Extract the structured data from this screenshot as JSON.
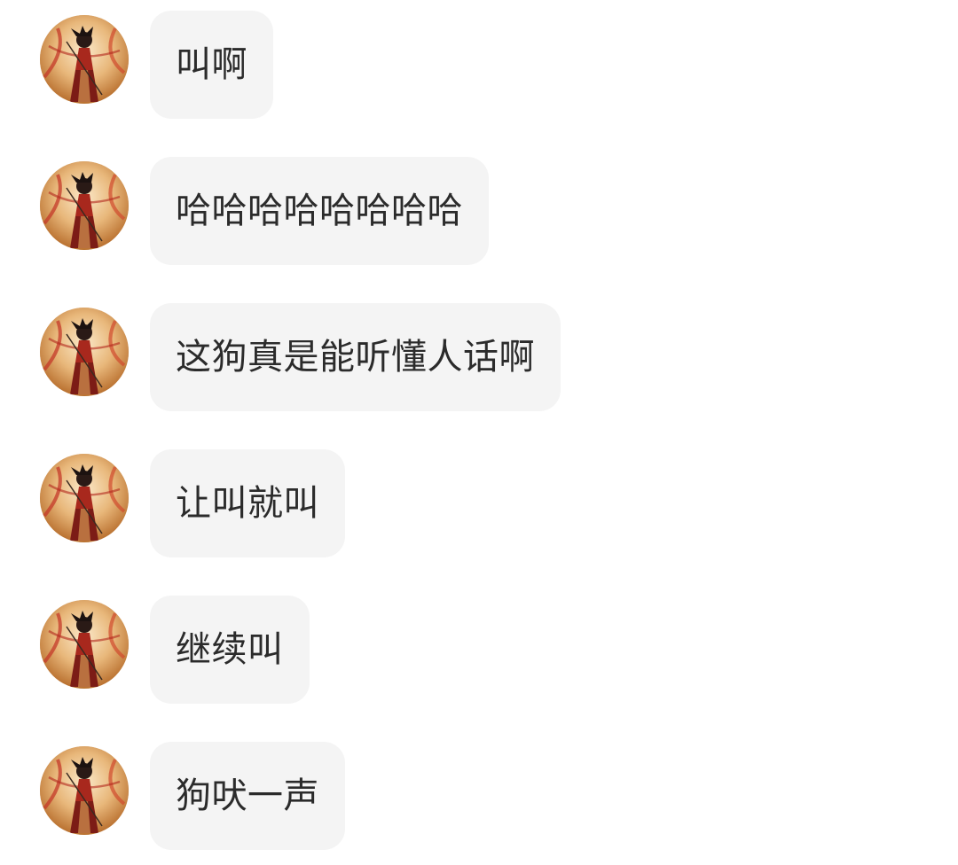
{
  "chat": {
    "messages": [
      {
        "sender_avatar": "anime-warrior-avatar",
        "text": "叫啊"
      },
      {
        "sender_avatar": "anime-warrior-avatar",
        "text": "哈哈哈哈哈哈哈哈"
      },
      {
        "sender_avatar": "anime-warrior-avatar",
        "text": "这狗真是能听懂人话啊"
      },
      {
        "sender_avatar": "anime-warrior-avatar",
        "text": "让叫就叫"
      },
      {
        "sender_avatar": "anime-warrior-avatar",
        "text": "继续叫"
      },
      {
        "sender_avatar": "anime-warrior-avatar",
        "text": "狗吠一声"
      }
    ]
  },
  "colors": {
    "background": "#ffffff",
    "bubble": "#f4f4f4",
    "text": "#2b2b2b"
  }
}
